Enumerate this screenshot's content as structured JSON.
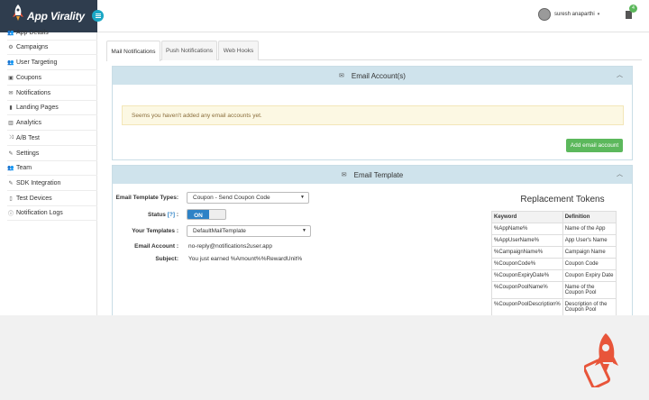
{
  "brand": {
    "name": "App Virality"
  },
  "header": {
    "user_name": "suresh anaparthi",
    "notification_count": "4"
  },
  "sidebar": {
    "items": [
      {
        "label": "App Details",
        "icon": "users-icon"
      },
      {
        "label": "Campaigns",
        "icon": "cogs-icon"
      },
      {
        "label": "User Targeting",
        "icon": "users-icon"
      },
      {
        "label": "Coupons",
        "icon": "coupon-icon"
      },
      {
        "label": "Notifications",
        "icon": "envelope-icon"
      },
      {
        "label": "Landing Pages",
        "icon": "bookmark-icon"
      },
      {
        "label": "Analytics",
        "icon": "chart-icon"
      },
      {
        "label": "A/B Test",
        "icon": "shuffle-icon"
      },
      {
        "label": "Settings",
        "icon": "wrench-icon"
      },
      {
        "label": "Team",
        "icon": "users-icon"
      },
      {
        "label": "SDK Integration",
        "icon": "wrench-icon"
      },
      {
        "label": "Test Devices",
        "icon": "mobile-icon"
      },
      {
        "label": "Notification Logs",
        "icon": "info-icon"
      }
    ]
  },
  "tabs": [
    {
      "label": "Mail Notifications",
      "active": true
    },
    {
      "label": "Push Notifications",
      "active": false
    },
    {
      "label": "Web Hooks",
      "active": false
    }
  ],
  "email_accounts": {
    "title": "Email Account(s)",
    "alert": "Seems you haven't added any email accounts yet.",
    "add_button": "Add email account"
  },
  "email_template": {
    "title": "Email Template",
    "type_label": "Email Template Types:",
    "type_value": "Coupon - Send Coupon Code",
    "status_label": "Status",
    "status_help": "[?]",
    "status_value": "ON",
    "templates_label": "Your Templates :",
    "templates_value": "DefaultMailTemplate",
    "account_label": "Email Account :",
    "account_value": "no-reply@notifications2user.app",
    "subject_label": "Subject:",
    "subject_value": "You just earned %Amount%%RewardUnit%"
  },
  "tokens": {
    "title": "Replacement Tokens",
    "headers": [
      "Keyword",
      "Definition"
    ],
    "rows": [
      [
        "%AppName%",
        "Name of the App"
      ],
      [
        "%AppUserName%",
        "App User's Name"
      ],
      [
        "%CampaignName%",
        "Campaign Name"
      ],
      [
        "%CouponCode%",
        "Coupon Code"
      ],
      [
        "%CouponExpiryDate%",
        "Coupon Expiry Date"
      ],
      [
        "%CouponPoolName%",
        "Name of the Coupon Pool"
      ],
      [
        "%CouponPoolDescription%",
        "Description of the Coupon Pool"
      ]
    ]
  },
  "colors": {
    "brand_dark": "#2f3d4e",
    "panel_head": "#cfe3ec",
    "success": "#5cb85c",
    "toggle_on": "#2e82c6",
    "rocket": "#e8553a"
  }
}
